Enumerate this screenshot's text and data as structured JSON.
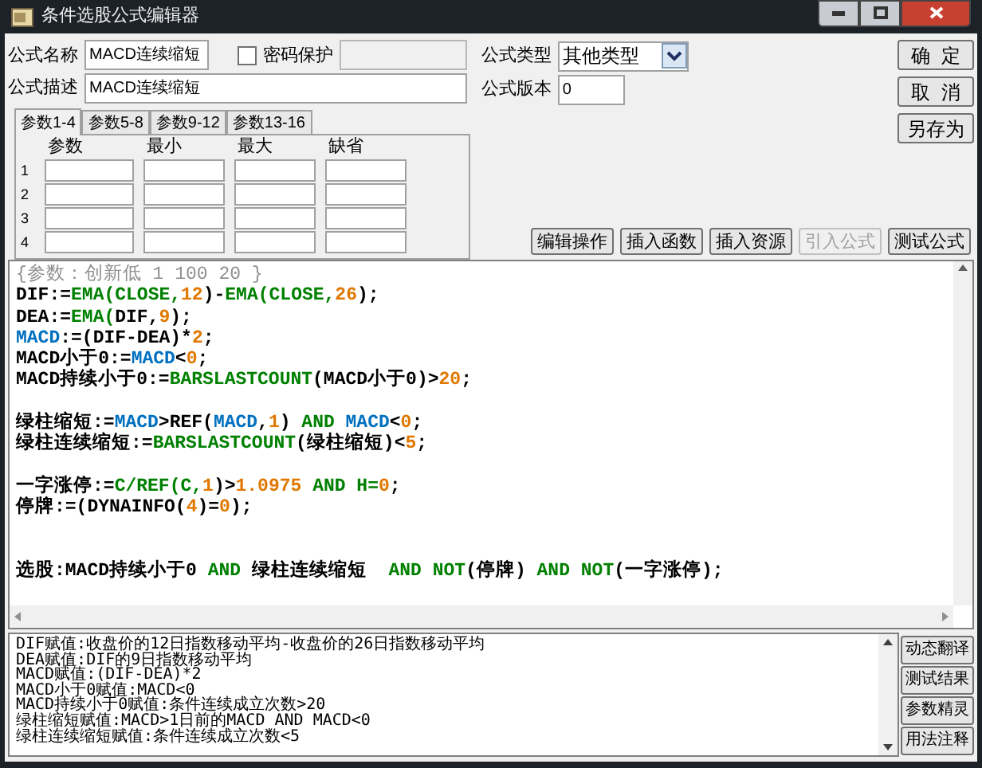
{
  "window": {
    "title": "条件选股公式编辑器"
  },
  "form": {
    "name_label": "公式名称",
    "name_value": "MACD连续缩短",
    "password": {
      "label": "密码保护",
      "checked": false
    },
    "type_label": "公式类型",
    "type_value": "其他类型",
    "desc_label": "公式描述",
    "desc_value": "MACD连续缩短",
    "version_label": "公式版本",
    "version_value": "0"
  },
  "side_buttons": [
    {
      "label": "确  定"
    },
    {
      "label": "取  消"
    },
    {
      "label": "另存为"
    }
  ],
  "param_tabs": [
    {
      "label": "参数1-4",
      "selected": true
    },
    {
      "label": "参数5-8",
      "selected": false
    },
    {
      "label": "参数9-12",
      "selected": false
    },
    {
      "label": "参数13-16",
      "selected": false
    }
  ],
  "param_table": {
    "columns": [
      "参数",
      "最小",
      "最大",
      "缺省"
    ],
    "rows": [
      "1",
      "2",
      "3",
      "4"
    ]
  },
  "toolbar": [
    {
      "label": "编辑操作",
      "disabled": false
    },
    {
      "label": "插入函数",
      "disabled": false
    },
    {
      "label": "插入资源",
      "disabled": false
    },
    {
      "label": "引入公式",
      "disabled": true
    },
    {
      "label": "测试公式",
      "disabled": false
    }
  ],
  "code": [
    [
      {
        "segments": [
          {
            "kind": "comment",
            "text": "{参数：创新低 1 100 20 }"
          }
        ]
      },
      {
        "segments": [
          {
            "kind": "text",
            "text": "DIF:="
          },
          {
            "kind": "func",
            "text": "EMA(CLOSE,"
          },
          {
            "kind": "num",
            "text": "12"
          },
          {
            "kind": "text",
            "text": ")-"
          },
          {
            "kind": "func",
            "text": "EMA(CLOSE,"
          },
          {
            "kind": "num",
            "text": "26"
          },
          {
            "kind": "text",
            "text": ");"
          }
        ]
      },
      {
        "segments": [
          {
            "kind": "text",
            "text": "DEA:="
          },
          {
            "kind": "func",
            "text": "EMA("
          },
          {
            "kind": "text",
            "text": "DIF,"
          },
          {
            "kind": "num",
            "text": "9"
          },
          {
            "kind": "text",
            "text": ");"
          }
        ]
      },
      {
        "segments": [
          {
            "kind": "var",
            "text": "MACD"
          },
          {
            "kind": "text",
            "text": ":=(DIF-DEA)*"
          },
          {
            "kind": "num",
            "text": "2"
          },
          {
            "kind": "text",
            "text": ";"
          }
        ]
      },
      {
        "segments": [
          {
            "kind": "text",
            "text": "MACD小于0:="
          },
          {
            "kind": "var",
            "text": "MACD"
          },
          {
            "kind": "text",
            "text": "<"
          },
          {
            "kind": "num",
            "text": "0"
          },
          {
            "kind": "text",
            "text": ";"
          }
        ]
      },
      {
        "segments": [
          {
            "kind": "text",
            "text": "MACD持续小于0:="
          },
          {
            "kind": "func",
            "text": "BARSLASTCOUNT"
          },
          {
            "kind": "text",
            "text": "(MACD小于0)>"
          },
          {
            "kind": "num",
            "text": "20"
          },
          {
            "kind": "text",
            "text": ";"
          }
        ]
      }
    ],
    [
      {
        "segments": [
          {
            "kind": "text",
            "text": "绿柱缩短:="
          },
          {
            "kind": "var",
            "text": "MACD"
          },
          {
            "kind": "text",
            "text": ">REF("
          },
          {
            "kind": "var",
            "text": "MACD"
          },
          {
            "kind": "text",
            "text": ","
          },
          {
            "kind": "num",
            "text": "1"
          },
          {
            "kind": "text",
            "text": ") "
          },
          {
            "kind": "func",
            "text": "AND "
          },
          {
            "kind": "var",
            "text": "MACD"
          },
          {
            "kind": "text",
            "text": "<"
          },
          {
            "kind": "num",
            "text": "0"
          },
          {
            "kind": "text",
            "text": ";"
          }
        ]
      },
      {
        "segments": [
          {
            "kind": "text",
            "text": "绿柱连续缩短:="
          },
          {
            "kind": "func",
            "text": "BARSLASTCOUNT"
          },
          {
            "kind": "text",
            "text": "(绿柱缩短)<"
          },
          {
            "kind": "num",
            "text": "5"
          },
          {
            "kind": "text",
            "text": ";"
          }
        ]
      }
    ],
    [
      {
        "segments": [
          {
            "kind": "text",
            "text": "一字涨停:="
          },
          {
            "kind": "func",
            "text": "C/REF(C,"
          },
          {
            "kind": "num",
            "text": "1"
          },
          {
            "kind": "text",
            "text": ")>"
          },
          {
            "kind": "num",
            "text": "1.0975"
          },
          {
            "kind": "func",
            "text": " AND H="
          },
          {
            "kind": "num",
            "text": "0"
          },
          {
            "kind": "text",
            "text": ";"
          }
        ]
      },
      {
        "segments": [
          {
            "kind": "text",
            "text": "停牌:=(DYNAINFO("
          },
          {
            "kind": "num",
            "text": "4"
          },
          {
            "kind": "text",
            "text": ")="
          },
          {
            "kind": "num",
            "text": "0"
          },
          {
            "kind": "text",
            "text": ");"
          }
        ]
      }
    ],
    [
      {
        "segments": [
          {
            "kind": "text",
            "text": "选股:MACD持续小于0 "
          },
          {
            "kind": "func",
            "text": "AND"
          },
          {
            "kind": "text",
            "text": " 绿柱连续缩短  "
          },
          {
            "kind": "func",
            "text": "AND NOT"
          },
          {
            "kind": "text",
            "text": "(停牌) "
          },
          {
            "kind": "func",
            "text": "AND NOT"
          },
          {
            "kind": "text",
            "text": "(一字涨停);"
          }
        ]
      }
    ]
  ],
  "description": [
    "DIF赋值:收盘价的12日指数移动平均-收盘价的26日指数移动平均",
    "DEA赋值:DIF的9日指数移动平均",
    "MACD赋值:(DIF-DEA)*2",
    "MACD小于0赋值:MACD<0",
    "MACD持续小于0赋值:条件连续成立次数>20",
    "绿柱缩短赋值:MACD>1日前的MACD AND MACD<0",
    "绿柱连续缩短赋值:条件连续成立次数<5"
  ],
  "help_buttons": [
    {
      "label": "动态翻译"
    },
    {
      "label": "测试结果"
    },
    {
      "label": "参数精灵"
    },
    {
      "label": "用法注释"
    }
  ]
}
